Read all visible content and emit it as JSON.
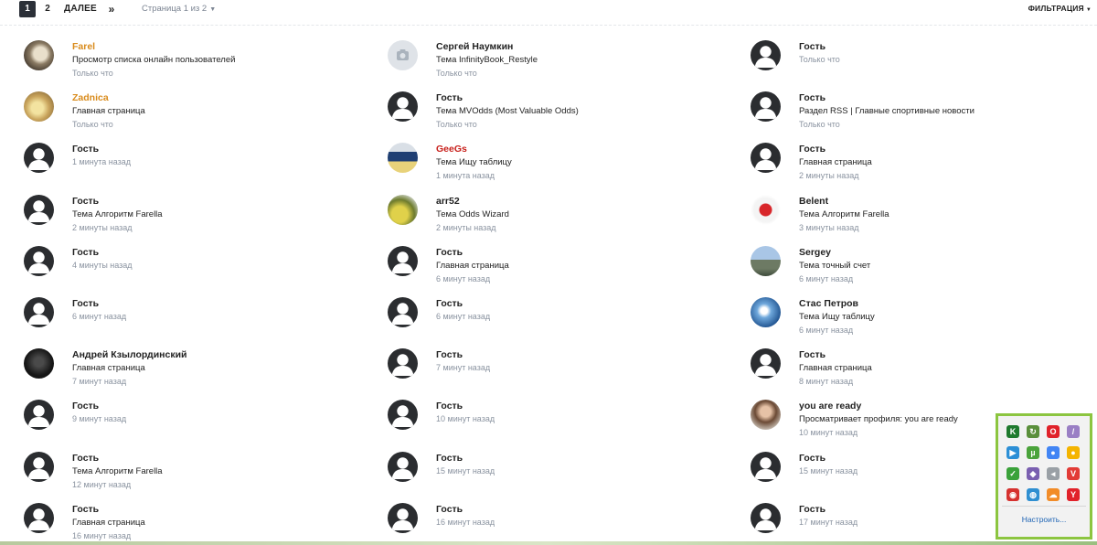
{
  "pagination": {
    "page1": "1",
    "page2": "2",
    "next": "ДАЛЕЕ",
    "last": "»",
    "page_of": "Страница 1 из 2",
    "filter": "ФИЛЬТРАЦИЯ"
  },
  "columns": [
    [
      {
        "name": "Farel",
        "loc": "Просмотр списка онлайн пользователей",
        "time": "Только что",
        "avatar": "photo1",
        "color": "orange"
      },
      {
        "name": "Zadnica",
        "loc": "Главная страница",
        "time": "Только что",
        "avatar": "photo2",
        "color": "orange"
      },
      {
        "name": "Гость",
        "loc": "",
        "time": "1 минута назад",
        "avatar": "guest",
        "color": ""
      },
      {
        "name": "Гость",
        "loc": "Тема Алгоритм Farella",
        "time": "2 минуты назад",
        "avatar": "guest",
        "color": ""
      },
      {
        "name": "Гость",
        "loc": "",
        "time": "4 минуты назад",
        "avatar": "guest",
        "color": ""
      },
      {
        "name": "Гость",
        "loc": "",
        "time": "6 минут назад",
        "avatar": "guest",
        "color": ""
      },
      {
        "name": "Андрей Кзылординский",
        "loc": "Главная страница",
        "time": "7 минут назад",
        "avatar": "andrey",
        "color": ""
      },
      {
        "name": "Гость",
        "loc": "",
        "time": "9 минут назад",
        "avatar": "guest",
        "color": ""
      },
      {
        "name": "Гость",
        "loc": "Тема Алгоритм Farella",
        "time": "12 минут назад",
        "avatar": "guest",
        "color": ""
      },
      {
        "name": "Гость",
        "loc": "Главная страница",
        "time": "16 минут назад",
        "avatar": "guest",
        "color": ""
      }
    ],
    [
      {
        "name": "Сергей Наумкин",
        "loc": "Тема InfinityBook_Restyle",
        "time": "Только что",
        "avatar": "camera",
        "color": ""
      },
      {
        "name": "Гость",
        "loc": "Тема MVOdds (Most Valuable Odds)",
        "time": "Только что",
        "avatar": "guest",
        "color": ""
      },
      {
        "name": "GeeGs",
        "loc": "Тема Ищу таблицу",
        "time": "1 минута назад",
        "avatar": "geegs",
        "color": "red"
      },
      {
        "name": "arr52",
        "loc": "Тема Odds Wizard",
        "time": "2 минуты назад",
        "avatar": "arr",
        "color": ""
      },
      {
        "name": "Гость",
        "loc": "Главная страница",
        "time": "6 минут назад",
        "avatar": "guest",
        "color": ""
      },
      {
        "name": "Гость",
        "loc": "",
        "time": "6 минут назад",
        "avatar": "guest",
        "color": ""
      },
      {
        "name": "Гость",
        "loc": "",
        "time": "7 минут назад",
        "avatar": "guest",
        "color": ""
      },
      {
        "name": "Гость",
        "loc": "",
        "time": "10 минут назад",
        "avatar": "guest",
        "color": ""
      },
      {
        "name": "Гость",
        "loc": "",
        "time": "15 минут назад",
        "avatar": "guest",
        "color": ""
      },
      {
        "name": "Гость",
        "loc": "",
        "time": "16 минут назад",
        "avatar": "guest",
        "color": ""
      }
    ],
    [
      {
        "name": "Гость",
        "loc": "",
        "time": "Только что",
        "avatar": "guest",
        "color": ""
      },
      {
        "name": "Гость",
        "loc": "Раздел RSS | Главные спортивные новости",
        "time": "Только что",
        "avatar": "guest",
        "color": ""
      },
      {
        "name": "Гость",
        "loc": "Главная страница",
        "time": "2 минуты назад",
        "avatar": "guest",
        "color": ""
      },
      {
        "name": "Belent",
        "loc": "Тема Алгоритм Farella",
        "time": "3 минуты назад",
        "avatar": "belent",
        "color": ""
      },
      {
        "name": "Sergey",
        "loc": "Тема точный счет",
        "time": "6 минут назад",
        "avatar": "sergey",
        "color": ""
      },
      {
        "name": "Стас Петров",
        "loc": "Тема Ищу таблицу",
        "time": "6 минут назад",
        "avatar": "stas",
        "color": ""
      },
      {
        "name": "Гость",
        "loc": "Главная страница",
        "time": "8 минут назад",
        "avatar": "guest",
        "color": ""
      },
      {
        "name": "you are ready",
        "loc": "Просматривает профиля: you are ready",
        "time": "10 минут назад",
        "avatar": "ready",
        "color": ""
      },
      {
        "name": "Гость",
        "loc": "",
        "time": "15 минут назад",
        "avatar": "guest",
        "color": ""
      },
      {
        "name": "Гость",
        "loc": "",
        "time": "17 минут назад",
        "avatar": "guest",
        "color": ""
      }
    ]
  ],
  "tray": {
    "link": "Настроить...",
    "icons": [
      {
        "name": "kaspersky-icon",
        "bg": "#1f7a2e",
        "glyph": "K"
      },
      {
        "name": "sync-icon",
        "bg": "#5a8f3b",
        "glyph": "↻"
      },
      {
        "name": "opera-icon",
        "bg": "#e0222a",
        "glyph": "O"
      },
      {
        "name": "pen-icon",
        "bg": "#9a7fc4",
        "glyph": "/"
      },
      {
        "name": "play-icon",
        "bg": "#2c8fd6",
        "glyph": "▶"
      },
      {
        "name": "utorrent-icon",
        "bg": "#4aa33b",
        "glyph": "µ"
      },
      {
        "name": "chrome-icon",
        "bg": "#4285f4",
        "glyph": "●"
      },
      {
        "name": "chrome-icon-2",
        "bg": "#f4b400",
        "glyph": "●"
      },
      {
        "name": "shield-check-icon",
        "bg": "#3aa23a",
        "glyph": "✓"
      },
      {
        "name": "network-icon",
        "bg": "#7a5fb0",
        "glyph": "◆"
      },
      {
        "name": "speaker-icon",
        "bg": "#9aa0a6",
        "glyph": "◂"
      },
      {
        "name": "vivaldi-icon",
        "bg": "#e23b36",
        "glyph": "V"
      },
      {
        "name": "camera-icon",
        "bg": "#d6322f",
        "glyph": "◉"
      },
      {
        "name": "globe-icon",
        "bg": "#2f8fd1",
        "glyph": "◍"
      },
      {
        "name": "cloud-icon",
        "bg": "#f28c28",
        "glyph": "☁"
      },
      {
        "name": "yandex-icon",
        "bg": "#e1222a",
        "glyph": "Y"
      }
    ]
  }
}
